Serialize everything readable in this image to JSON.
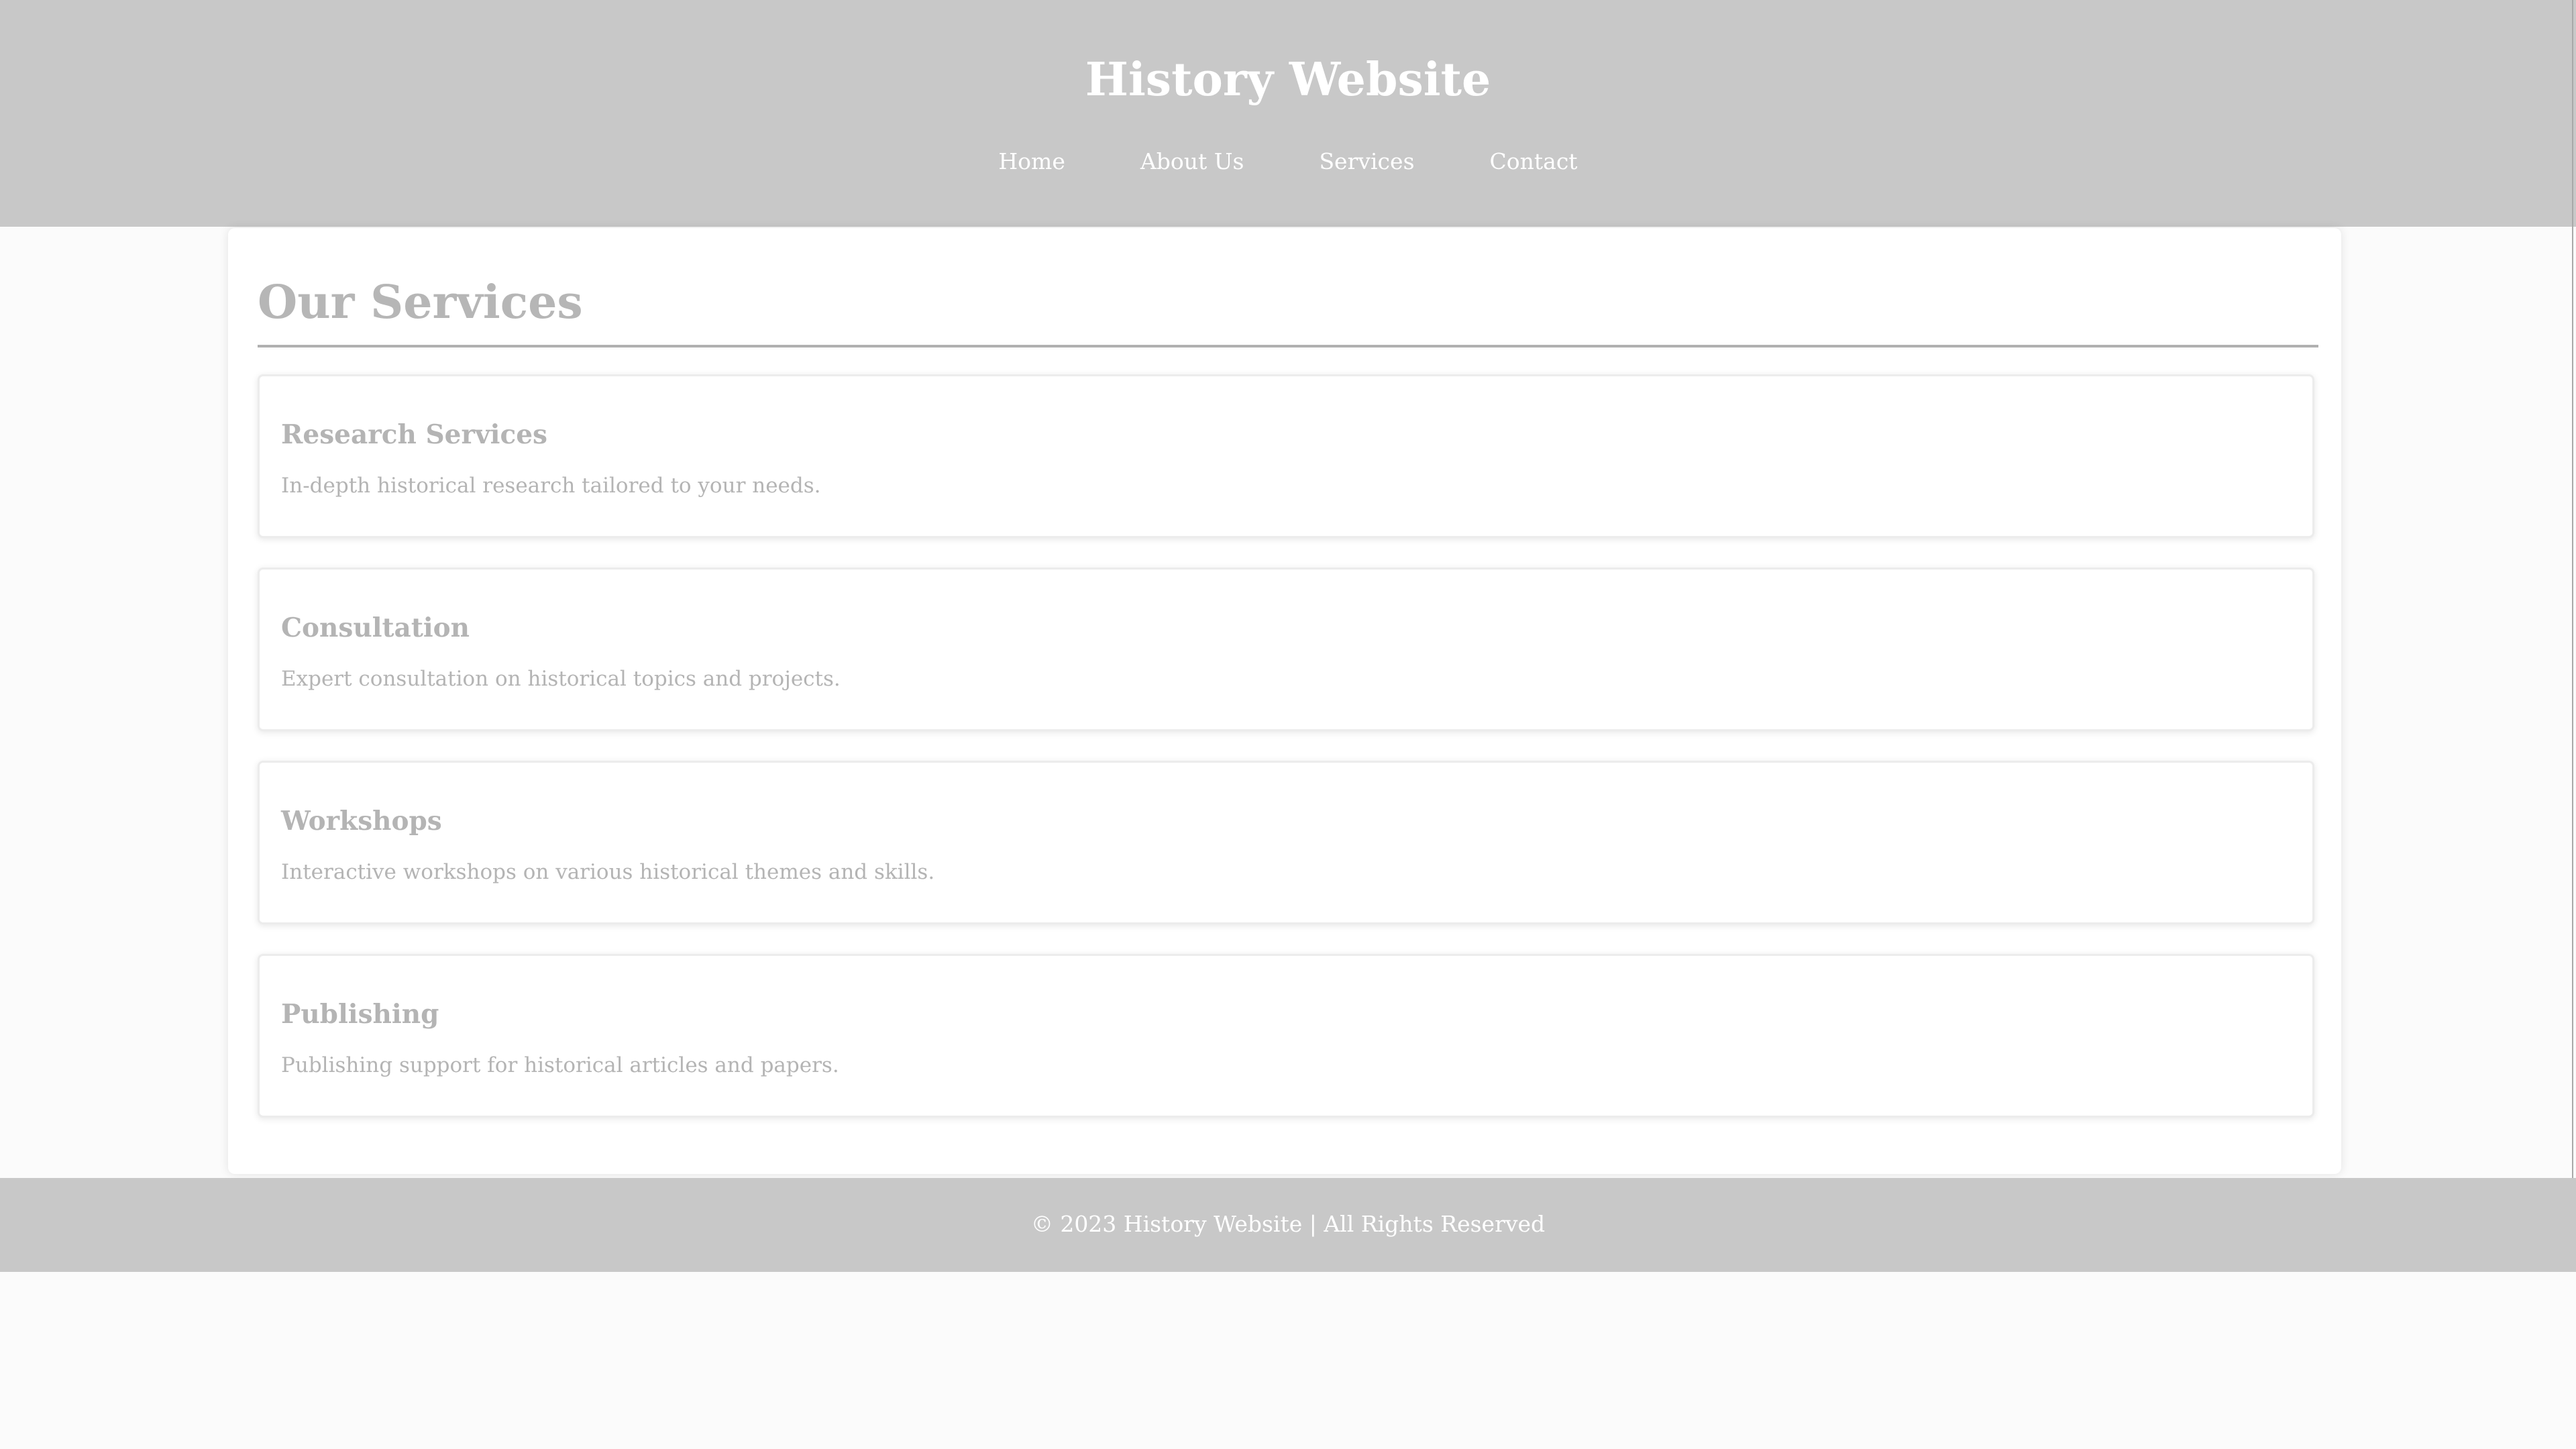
{
  "header": {
    "title": "History Website",
    "nav": [
      {
        "label": "Home"
      },
      {
        "label": "About Us"
      },
      {
        "label": "Services"
      },
      {
        "label": "Contact"
      }
    ]
  },
  "main": {
    "title": "Our Services",
    "services": [
      {
        "title": "Research Services",
        "description": "In-depth historical research tailored to your needs."
      },
      {
        "title": "Consultation",
        "description": "Expert consultation on historical topics and projects."
      },
      {
        "title": "Workshops",
        "description": "Interactive workshops on various historical themes and skills."
      },
      {
        "title": "Publishing",
        "description": "Publishing support for historical articles and papers."
      }
    ]
  },
  "footer": {
    "text": "© 2023 History Website | All Rights Reserved"
  },
  "colors": {
    "header_bg": "#c8c8c8",
    "page_bg": "#fbfbfb",
    "text_muted": "#b4b4b4",
    "header_text": "#ffffff"
  }
}
